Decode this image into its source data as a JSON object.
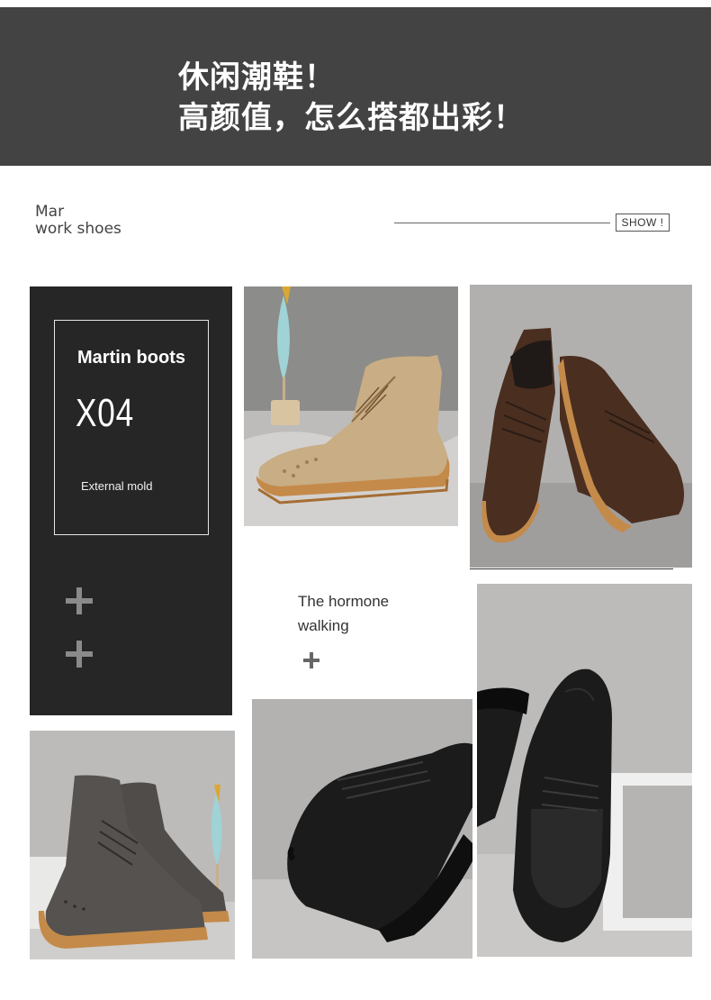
{
  "banner": {
    "line1": "休闲潮鞋！",
    "line2": "高颜值，怎么搭都出彩！"
  },
  "section": {
    "title_line1": "Mar",
    "title_line2": "work shoes",
    "show_label": "SHOW !"
  },
  "product": {
    "name": "Martin boots",
    "model": "X04",
    "feature": "External mold"
  },
  "tagline": {
    "line1": "The hormone",
    "line2": "walking"
  },
  "colors": {
    "banner_bg": "#434343",
    "panel_bg": "#262626",
    "khaki_suede": "#c9ad84",
    "brown_suede": "#4a2e20",
    "grey_suede": "#55524f",
    "black_suede": "#1b1b1b",
    "gum_sole": "#c48a4a"
  },
  "icons": [
    "plus-icon",
    "plus-icon",
    "plus-icon"
  ]
}
